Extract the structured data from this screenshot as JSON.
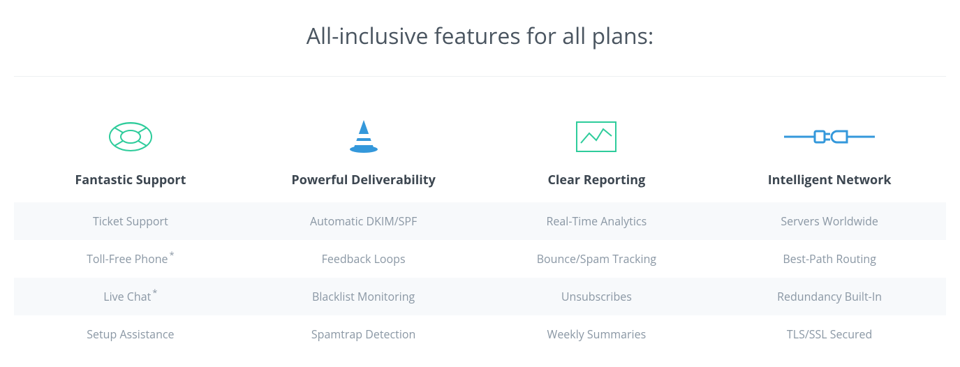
{
  "title": "All-inclusive features for all plans:",
  "columns": [
    {
      "icon": "lifebuoy-icon",
      "title": "Fantastic Support",
      "items": [
        {
          "text": "Ticket Support",
          "asterisk": false
        },
        {
          "text": "Toll-Free Phone",
          "asterisk": true
        },
        {
          "text": "Live Chat",
          "asterisk": true
        },
        {
          "text": "Setup Assistance",
          "asterisk": false
        }
      ]
    },
    {
      "icon": "cone-icon",
      "title": "Powerful Deliverability",
      "items": [
        {
          "text": "Automatic DKIM/SPF",
          "asterisk": false
        },
        {
          "text": "Feedback Loops",
          "asterisk": false
        },
        {
          "text": "Blacklist Monitoring",
          "asterisk": false
        },
        {
          "text": "Spamtrap Detection",
          "asterisk": false
        }
      ]
    },
    {
      "icon": "chart-icon",
      "title": "Clear Reporting",
      "items": [
        {
          "text": "Real-Time Analytics",
          "asterisk": false
        },
        {
          "text": "Bounce/Spam Tracking",
          "asterisk": false
        },
        {
          "text": "Unsubscribes",
          "asterisk": false
        },
        {
          "text": "Weekly Summaries",
          "asterisk": false
        }
      ]
    },
    {
      "icon": "plug-icon",
      "title": "Intelligent Network",
      "items": [
        {
          "text": "Servers Worldwide",
          "asterisk": false
        },
        {
          "text": "Best-Path Routing",
          "asterisk": false
        },
        {
          "text": "Redundancy Built-In",
          "asterisk": false
        },
        {
          "text": "TLS/SSL Secured",
          "asterisk": false
        }
      ]
    }
  ],
  "colors": {
    "green": "#2ecc9b",
    "blue": "#3498db"
  }
}
